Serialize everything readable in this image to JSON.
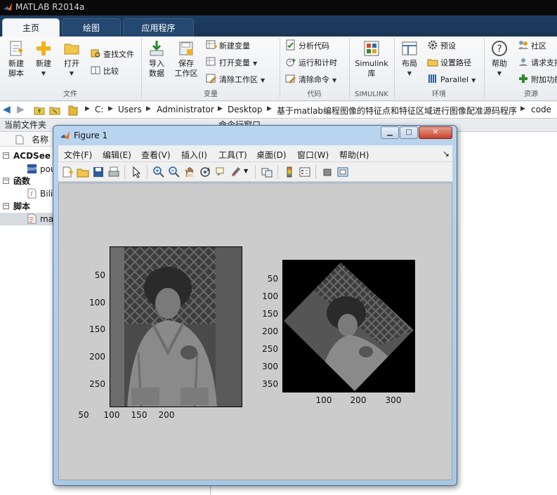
{
  "app": {
    "title": "MATLAB R2014a"
  },
  "tabs": [
    {
      "label": "主页",
      "active": true
    },
    {
      "label": "绘图",
      "active": false
    },
    {
      "label": "应用程序",
      "active": false
    }
  ],
  "ribbon": {
    "new_script": "新建\n脚本",
    "new": "新建",
    "open": "打开",
    "find_files": "查找文件",
    "compare": "比较",
    "group_file": "文件",
    "import_data": "导入\n数据",
    "save_workspace": "保存\n工作区",
    "new_variable": "新建变量",
    "open_variable": "打开变量",
    "clear_workspace": "清除工作区",
    "group_variable": "变量",
    "analyze_code": "分析代码",
    "run_and_time": "运行和计时",
    "clear_commands": "清除命令",
    "group_code": "代码",
    "simulink_library": "Simulink\n库",
    "group_simulink": "SIMULINK",
    "layout": "布局",
    "preferences": "预设",
    "set_path": "设置路径",
    "parallel": "Parallel",
    "group_environment": "环境",
    "help": "帮助",
    "community": "社区",
    "request_support": "请求支持",
    "add_ons": "附加功能",
    "group_resources": "资源"
  },
  "address": {
    "path": [
      "C:",
      "Users",
      "Administrator",
      "Desktop",
      "基于matlab编程图像的特征点和特征区域进行图像配准源码程序",
      "code"
    ]
  },
  "current_folder": {
    "header": "当前文件夹",
    "column_name": "名称",
    "sections": [
      {
        "label": "ACDSee BMP",
        "items": [
          {
            "name": "pout"
          }
        ]
      },
      {
        "label": "函数",
        "items": [
          {
            "name": "Bilin"
          }
        ]
      },
      {
        "label": "脚本",
        "items": [
          {
            "name": "main"
          }
        ]
      }
    ]
  },
  "command_window": {
    "header": "命令行窗口"
  },
  "figure": {
    "title": "Figure 1",
    "menu": [
      "文件(F)",
      "编辑(E)",
      "查看(V)",
      "插入(I)",
      "工具(T)",
      "桌面(D)",
      "窗口(W)",
      "帮助(H)"
    ],
    "menu_arrow": "↘",
    "axes1": {
      "xticks": [
        "50",
        "100",
        "150",
        "200"
      ],
      "yticks": [
        "50",
        "100",
        "150",
        "200",
        "250"
      ]
    },
    "axes2": {
      "xticks": [
        "100",
        "200",
        "300"
      ],
      "yticks": [
        "50",
        "100",
        "150",
        "200",
        "250",
        "300",
        "350"
      ]
    }
  }
}
